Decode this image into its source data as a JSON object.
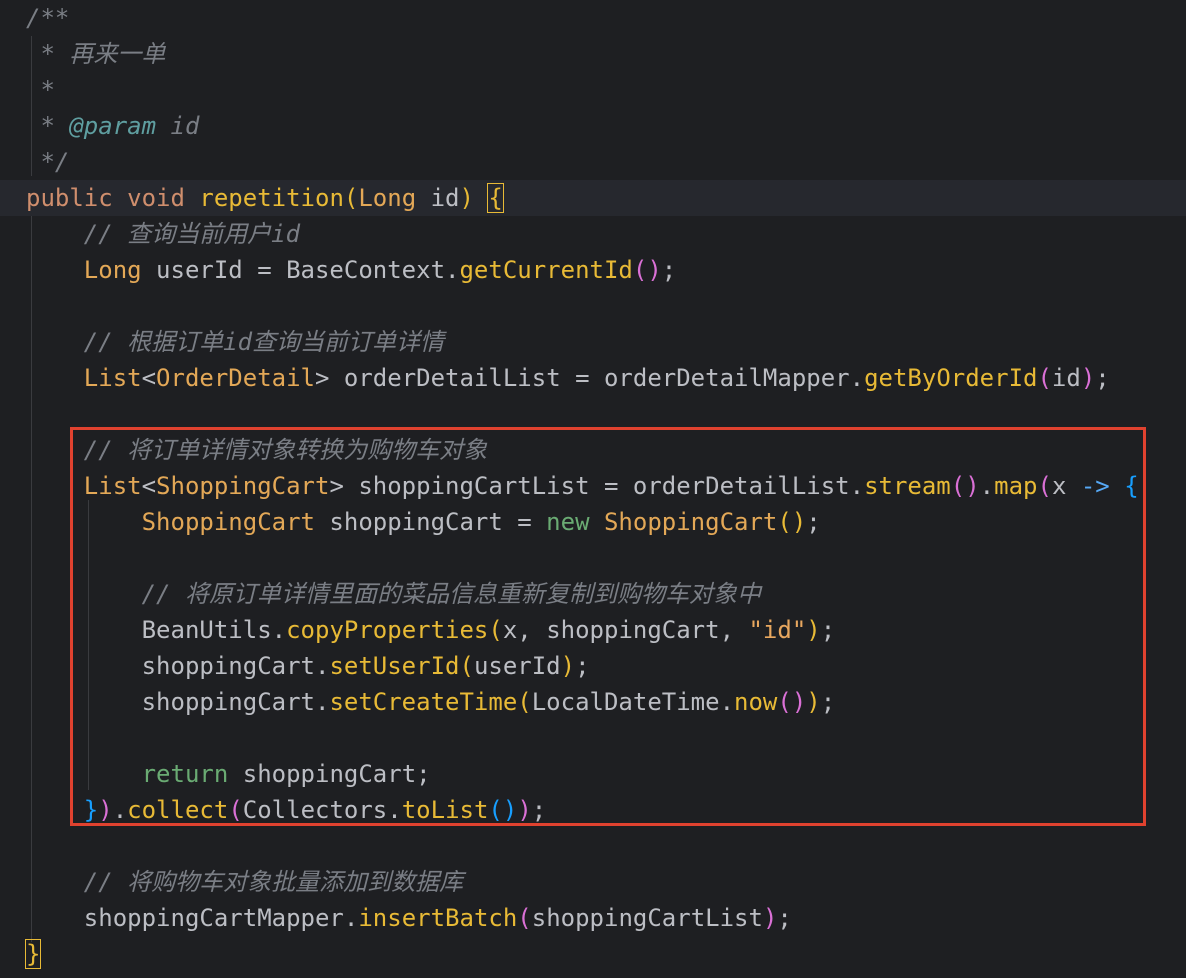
{
  "editor": {
    "lines": [
      {
        "tokens": [
          {
            "c": "t-comment",
            "t": "/**"
          }
        ]
      },
      {
        "tokens": [
          {
            "c": "t-comment",
            "t": " * 再来一单"
          }
        ]
      },
      {
        "tokens": [
          {
            "c": "t-comment",
            "t": " *"
          }
        ]
      },
      {
        "tokens": [
          {
            "c": "t-comment",
            "t": " * "
          },
          {
            "c": "t-doctag",
            "t": "@param"
          },
          {
            "c": "t-comment",
            "t": " id"
          }
        ]
      },
      {
        "tokens": [
          {
            "c": "t-comment",
            "t": " */"
          }
        ]
      },
      {
        "current": true,
        "tokens": [
          {
            "c": "t-kw",
            "t": "public"
          },
          {
            "c": "t-plain",
            "t": " "
          },
          {
            "c": "t-kw",
            "t": "void"
          },
          {
            "c": "t-plain",
            "t": " "
          },
          {
            "c": "t-yellow",
            "t": "repetition"
          },
          {
            "c": "t-paren1",
            "t": "("
          },
          {
            "c": "t-orange",
            "t": "Long"
          },
          {
            "c": "t-plain",
            "t": " id"
          },
          {
            "c": "t-paren1",
            "t": ")"
          },
          {
            "c": "t-plain",
            "t": " "
          },
          {
            "c": "t-paren1 bracket-match",
            "t": "{"
          }
        ]
      },
      {
        "tokens": [
          {
            "c": "t-comment",
            "t": "    // 查询当前用户id"
          }
        ]
      },
      {
        "tokens": [
          {
            "c": "t-plain",
            "t": "    "
          },
          {
            "c": "t-orange",
            "t": "Long"
          },
          {
            "c": "t-plain",
            "t": " userId = BaseContext."
          },
          {
            "c": "t-yellow",
            "t": "getCurrentId"
          },
          {
            "c": "t-paren2",
            "t": "()"
          },
          {
            "c": "t-plain",
            "t": ";"
          }
        ]
      },
      {
        "tokens": [
          {
            "c": "t-plain",
            "t": ""
          }
        ]
      },
      {
        "tokens": [
          {
            "c": "t-comment",
            "t": "    // 根据订单id查询当前订单详情"
          }
        ]
      },
      {
        "tokens": [
          {
            "c": "t-plain",
            "t": "    "
          },
          {
            "c": "t-orange",
            "t": "List"
          },
          {
            "c": "t-plain",
            "t": "<"
          },
          {
            "c": "t-orange",
            "t": "OrderDetail"
          },
          {
            "c": "t-plain",
            "t": "> orderDetailList = orderDetailMapper."
          },
          {
            "c": "t-yellow",
            "t": "getByOrderId"
          },
          {
            "c": "t-paren2",
            "t": "("
          },
          {
            "c": "t-plain",
            "t": "id"
          },
          {
            "c": "t-paren2",
            "t": ")"
          },
          {
            "c": "t-plain",
            "t": ";"
          }
        ]
      },
      {
        "tokens": [
          {
            "c": "t-plain",
            "t": ""
          }
        ]
      },
      {
        "tokens": [
          {
            "c": "t-comment",
            "t": "    // 将订单详情对象转换为购物车对象"
          }
        ]
      },
      {
        "tokens": [
          {
            "c": "t-plain",
            "t": "    "
          },
          {
            "c": "t-orange",
            "t": "List"
          },
          {
            "c": "t-plain",
            "t": "<"
          },
          {
            "c": "t-orange",
            "t": "ShoppingCart"
          },
          {
            "c": "t-plain",
            "t": "> shoppingCartList = orderDetailList."
          },
          {
            "c": "t-yellow",
            "t": "stream"
          },
          {
            "c": "t-paren2",
            "t": "()"
          },
          {
            "c": "t-plain",
            "t": "."
          },
          {
            "c": "t-yellow",
            "t": "map"
          },
          {
            "c": "t-paren2",
            "t": "("
          },
          {
            "c": "t-plain",
            "t": "x "
          },
          {
            "c": "t-arrow",
            "t": "->"
          },
          {
            "c": "t-plain",
            "t": " "
          },
          {
            "c": "t-paren3",
            "t": "{"
          }
        ]
      },
      {
        "tokens": [
          {
            "c": "t-plain",
            "t": "        "
          },
          {
            "c": "t-orange",
            "t": "ShoppingCart"
          },
          {
            "c": "t-plain",
            "t": " shoppingCart = "
          },
          {
            "c": "t-green",
            "t": "new"
          },
          {
            "c": "t-plain",
            "t": " "
          },
          {
            "c": "t-orange",
            "t": "ShoppingCart"
          },
          {
            "c": "t-paren1",
            "t": "()"
          },
          {
            "c": "t-plain",
            "t": ";"
          }
        ]
      },
      {
        "tokens": [
          {
            "c": "t-plain",
            "t": ""
          }
        ]
      },
      {
        "tokens": [
          {
            "c": "t-comment",
            "t": "        // 将原订单详情里面的菜品信息重新复制到购物车对象中"
          }
        ]
      },
      {
        "tokens": [
          {
            "c": "t-plain",
            "t": "        BeanUtils."
          },
          {
            "c": "t-yellow",
            "t": "copyProperties"
          },
          {
            "c": "t-paren1",
            "t": "("
          },
          {
            "c": "t-plain",
            "t": "x, shoppingCart, "
          },
          {
            "c": "t-string",
            "t": "\"id\""
          },
          {
            "c": "t-paren1",
            "t": ")"
          },
          {
            "c": "t-plain",
            "t": ";"
          }
        ]
      },
      {
        "tokens": [
          {
            "c": "t-plain",
            "t": "        shoppingCart."
          },
          {
            "c": "t-yellow",
            "t": "setUserId"
          },
          {
            "c": "t-paren1",
            "t": "("
          },
          {
            "c": "t-plain",
            "t": "userId"
          },
          {
            "c": "t-paren1",
            "t": ")"
          },
          {
            "c": "t-plain",
            "t": ";"
          }
        ]
      },
      {
        "tokens": [
          {
            "c": "t-plain",
            "t": "        shoppingCart."
          },
          {
            "c": "t-yellow",
            "t": "setCreateTime"
          },
          {
            "c": "t-paren1",
            "t": "("
          },
          {
            "c": "t-plain",
            "t": "LocalDateTime."
          },
          {
            "c": "t-yellow",
            "t": "now"
          },
          {
            "c": "t-paren2",
            "t": "()"
          },
          {
            "c": "t-paren1",
            "t": ")"
          },
          {
            "c": "t-plain",
            "t": ";"
          }
        ]
      },
      {
        "tokens": [
          {
            "c": "t-plain",
            "t": ""
          }
        ]
      },
      {
        "tokens": [
          {
            "c": "t-plain",
            "t": "        "
          },
          {
            "c": "t-green",
            "t": "return"
          },
          {
            "c": "t-plain",
            "t": " shoppingCart;"
          }
        ]
      },
      {
        "tokens": [
          {
            "c": "t-plain",
            "t": "    "
          },
          {
            "c": "t-paren3",
            "t": "}"
          },
          {
            "c": "t-paren2",
            "t": ")"
          },
          {
            "c": "t-plain",
            "t": "."
          },
          {
            "c": "t-yellow",
            "t": "collect"
          },
          {
            "c": "t-paren2",
            "t": "("
          },
          {
            "c": "t-plain",
            "t": "Collectors."
          },
          {
            "c": "t-yellow",
            "t": "toList"
          },
          {
            "c": "t-paren3",
            "t": "()"
          },
          {
            "c": "t-paren2",
            "t": ")"
          },
          {
            "c": "t-plain",
            "t": ";"
          }
        ]
      },
      {
        "tokens": [
          {
            "c": "t-plain",
            "t": ""
          }
        ]
      },
      {
        "tokens": [
          {
            "c": "t-comment",
            "t": "    // 将购物车对象批量添加到数据库"
          }
        ]
      },
      {
        "tokens": [
          {
            "c": "t-plain",
            "t": "    shoppingCartMapper."
          },
          {
            "c": "t-yellow",
            "t": "insertBatch"
          },
          {
            "c": "t-paren2",
            "t": "("
          },
          {
            "c": "t-plain",
            "t": "shoppingCartList"
          },
          {
            "c": "t-paren2",
            "t": ")"
          },
          {
            "c": "t-plain",
            "t": ";"
          }
        ]
      },
      {
        "tokens": [
          {
            "c": "t-paren1 bracket-match",
            "t": "}"
          }
        ]
      }
    ]
  },
  "colors": {
    "background": "#1e1f22",
    "current_line": "#26282e",
    "highlight_box": "#e0422f"
  }
}
